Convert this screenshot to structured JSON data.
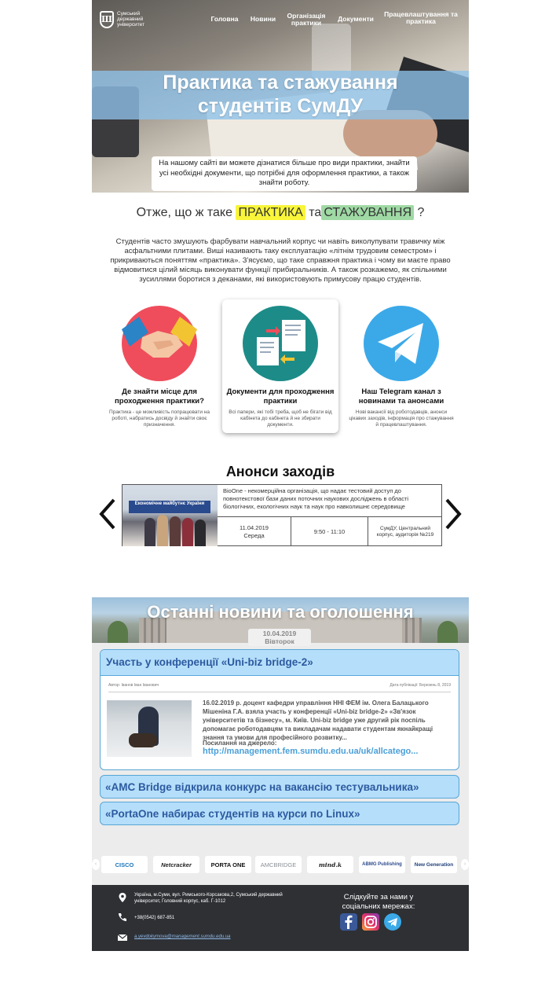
{
  "brand": {
    "logo_text": "Сумський державний університет",
    "logo_letter": "Ш"
  },
  "nav": {
    "items": [
      {
        "label": "Головна"
      },
      {
        "label": "Новини"
      },
      {
        "label": "Організація практики"
      },
      {
        "label": "Документи"
      },
      {
        "label": "Працевлаштування та практика"
      }
    ]
  },
  "hero": {
    "title_line1": "Практика та стажування",
    "title_line2": "студентів  СумДУ",
    "subtitle": "На нашому сайті ви можете дізнатися більше про види практики, знайти усі необхідні документи, що потрібні для оформлення практики, а також знайти роботу."
  },
  "intro": {
    "q_prefix": "Отже, що ж таке",
    "q_word1": "ПРАКТИКА",
    "q_and": "та",
    "q_word2": "СТАЖУВАННЯ",
    "q_suffix": "?",
    "text": "Студентів часто змушують фарбувати навчальний корпус чи навіть виколупувати травичку між асфальтними плитами. Виші називають таку експлуатацію «літнім трудовим семестром» і прикриваються поняттям «практика». З'ясуємо, що таке справжня практика і чому ви маєте право відмовитися цілий місяць виконувати функції прибиральників. А також розкажемо, як спільними зусиллями боротися з деканами, які використовують примусову працю студентів."
  },
  "cards": [
    {
      "title": "Де знайти місце для проходження практики?",
      "desc": "Практика - це можливість попрацювати на роботі, набратись досвіду й знайти своє призначення.",
      "icon": "handshake-icon",
      "color": "#ef4d5c"
    },
    {
      "title": "Документи для проходження практики",
      "desc": "Всі папери, які тобі треба, щоб не бігати від кабінета до кабінета й не збирати документи.",
      "icon": "documents-icon",
      "color": "#1d8c88"
    },
    {
      "title": "Наш Telegram канал з новинами та анонсами",
      "desc": "Нові вакансії від роботодавців, анонси цікавих заходів, інформація про стажування й працевлаштування.",
      "icon": "telegram-icon",
      "color": "#3ba9e8"
    }
  ],
  "announcements": {
    "title": "Анонси заходів",
    "image_banner": "Економічне майбутнє України",
    "text": "BioOne - некомерційна організація, що надає тестовий доступ до повнотекстової бази даних поточних наукових досліджень в області біологічних, екологічних наук та наук про навколишнє середовище",
    "date": "11.04.2019",
    "weekday": "Середа",
    "time": "9:50 - 11:10",
    "place": "СумДУ, Центральний корпус, аудиторія №219"
  },
  "news": {
    "title": "Останні новини та оголошення",
    "date": "10.04.2019",
    "weekday": "Вівторок",
    "featured": {
      "headline": "Участь у конференції «Uni-biz bridge-2»",
      "author": "Автор: Іванов Іван Іванович",
      "published": "Дата публікації: Березень 8, 2019",
      "body": "16.02.2019 р. доцент кафедри управління ННІ ФЕМ ім. Олега Балацького Мішеніна Г.А. взяла участь у конференції «Uni-biz bridge-2» «Зв'язок університетів та бізнесу», м. Київ. Uni-biz bridge уже другий рік поспіль допомагає роботодавцям та викладачам надавати студентам якнайкращі знання та умови для професійного розвитку...",
      "source_label": "Посилання на джерело:",
      "source_url": "http://management.fem.sumdu.edu.ua/uk/allcatego..."
    },
    "items": [
      {
        "headline": "«AMC Bridge відкрила конкурс на вакансію тестувальника»"
      },
      {
        "headline": "«PortaOne набирає студентів на курси по Linux»"
      }
    ]
  },
  "partners": [
    "CISCO",
    "Netcracker",
    "PORTA ONE",
    "AMCBRIDGE",
    "mind.k",
    "ABMG Publishing",
    "New Generation"
  ],
  "footer": {
    "address": "Україна, м.Суми, вул. Римського-Корсакова,2, Сумський державний університет, Головний корпус, каб. Г-1012",
    "phone": "+38(0542) 687-851",
    "email": "a.yevdokymova@management.sumdu.edu.ua",
    "follow": "Слідкуйте за нами у соціальних мережах:"
  },
  "colors": {
    "accent": "#58a6d6",
    "news_bg": "#b5defa",
    "footer": "#2e3034",
    "highlight_yellow": "#f8f53a",
    "highlight_green": "#9fd9a4"
  }
}
